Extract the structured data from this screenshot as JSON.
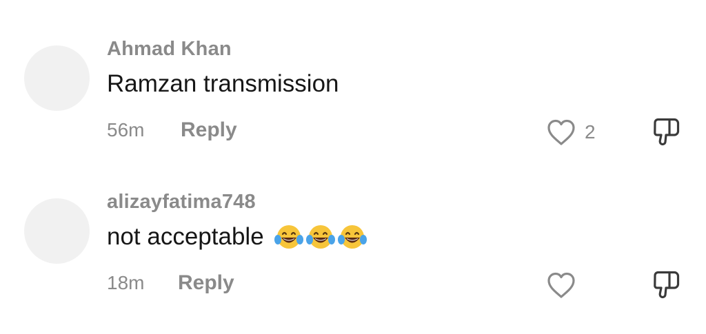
{
  "comments": [
    {
      "username": "Ahmad Khan",
      "text": "Ramzan transmission",
      "emojis": [],
      "timestamp": "56m",
      "reply_label": "Reply",
      "like_count": "2"
    },
    {
      "username": "alizayfatima748",
      "text": "not acceptable",
      "emojis": [
        "face-with-tears-of-joy",
        "face-with-tears-of-joy",
        "face-with-tears-of-joy"
      ],
      "timestamp": "18m",
      "reply_label": "Reply",
      "like_count": ""
    }
  ],
  "icons": {
    "like": "heart-outline-icon",
    "dislike": "thumbs-down-outline-icon"
  },
  "colors": {
    "background": "#ffffff",
    "username": "#8a8a8a",
    "text": "#161616",
    "meta": "#8a8a8a",
    "avatar_placeholder": "#f1f1f1"
  }
}
